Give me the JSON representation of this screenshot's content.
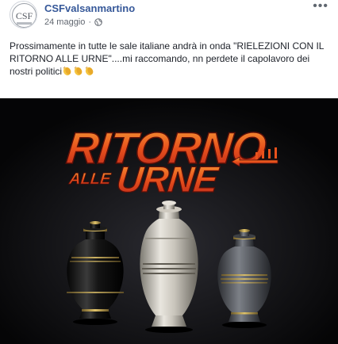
{
  "post": {
    "author": "CSFvalsanmartino",
    "avatar_text": "CSF",
    "date": "24 maggio",
    "text": "Prossimamente in tutte le sale italiane andrà in onda \"RIELEZIONI CON IL RITORNO ALLE URNE\"....mi raccomando, nn perdete il capolavoro dei nostri politici",
    "emoji": [
      "clapping-hands",
      "clapping-hands",
      "clapping-hands"
    ]
  },
  "image": {
    "title_line1": "RITORNO",
    "title_line2_small": "ALLE",
    "title_line2_big": "URNE",
    "urns": [
      "black-urn",
      "silver-urn",
      "gray-urn"
    ]
  },
  "icons": {
    "privacy": "globe-icon",
    "menu": "more-options-icon"
  },
  "colors": {
    "author_link": "#365899",
    "meta_text": "#616770",
    "title_fill": "#e8521c",
    "image_bg": "#050506"
  }
}
